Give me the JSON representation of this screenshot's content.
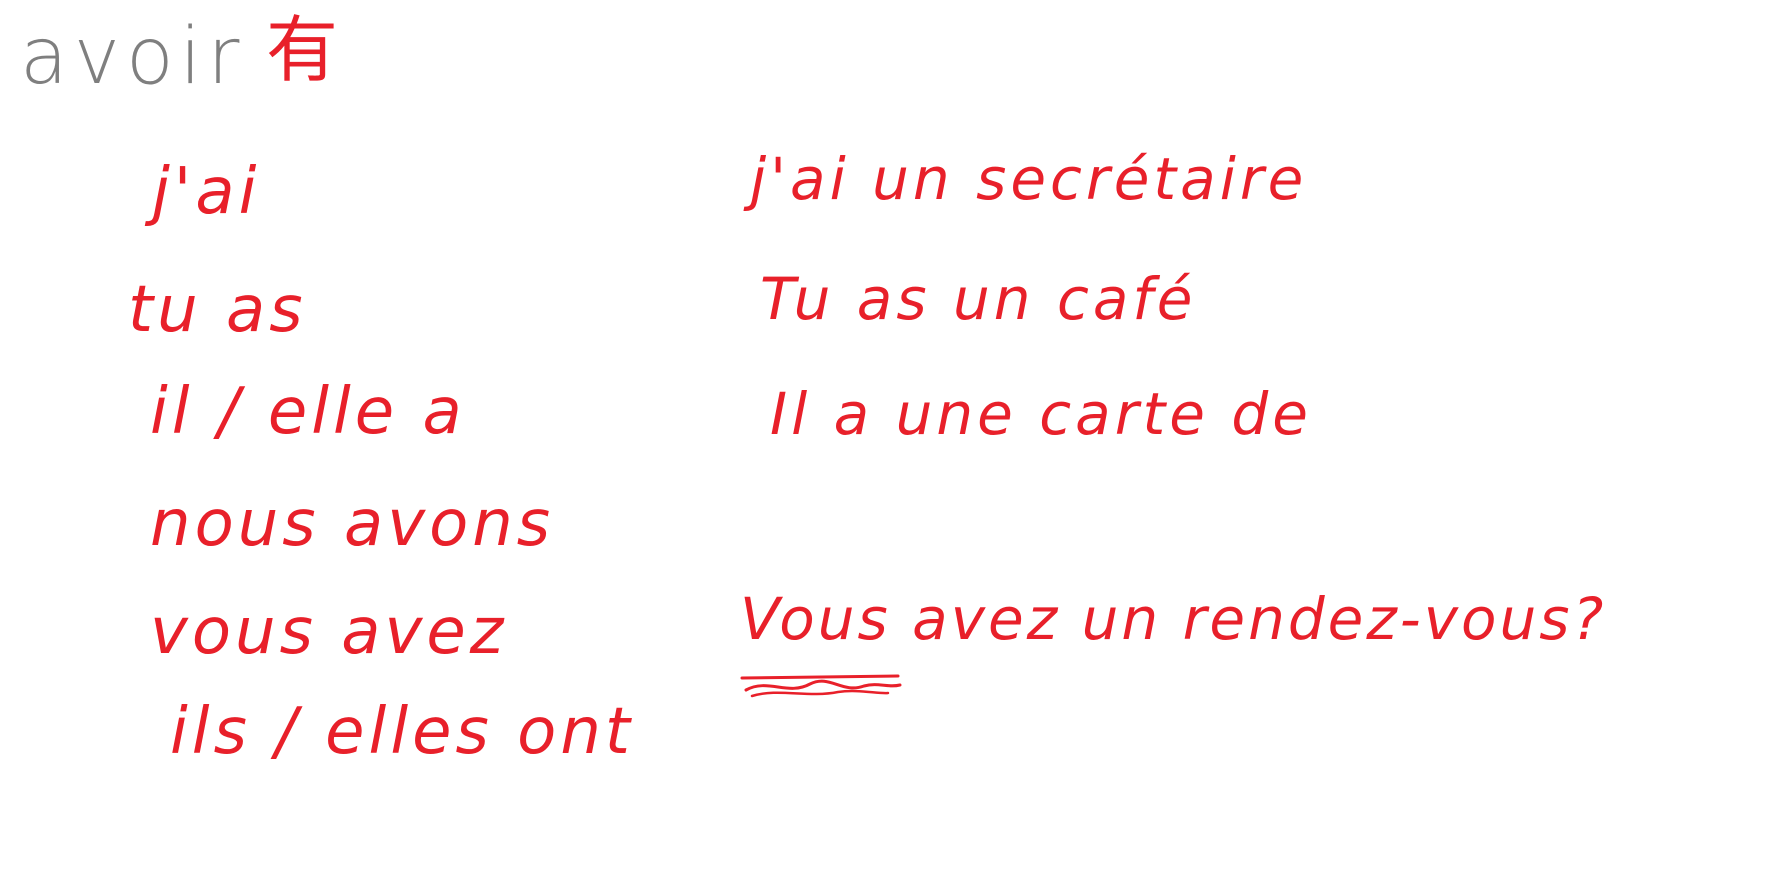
{
  "title": {
    "verb": "avoir",
    "chinese": "有"
  },
  "conjugations": [
    "j'ai",
    "tu as",
    "il / elle a",
    "nous avons",
    "vous avez",
    "ils / elles ont"
  ],
  "examples": [
    "j'ai un secrétaire",
    "Tu as un café",
    "Il a une carte de",
    "Vous avez un rendez-vous?"
  ],
  "colors": {
    "ink_red": "#e8202a",
    "ink_gray": "#7f7f7f",
    "paper": "#ffffff"
  }
}
